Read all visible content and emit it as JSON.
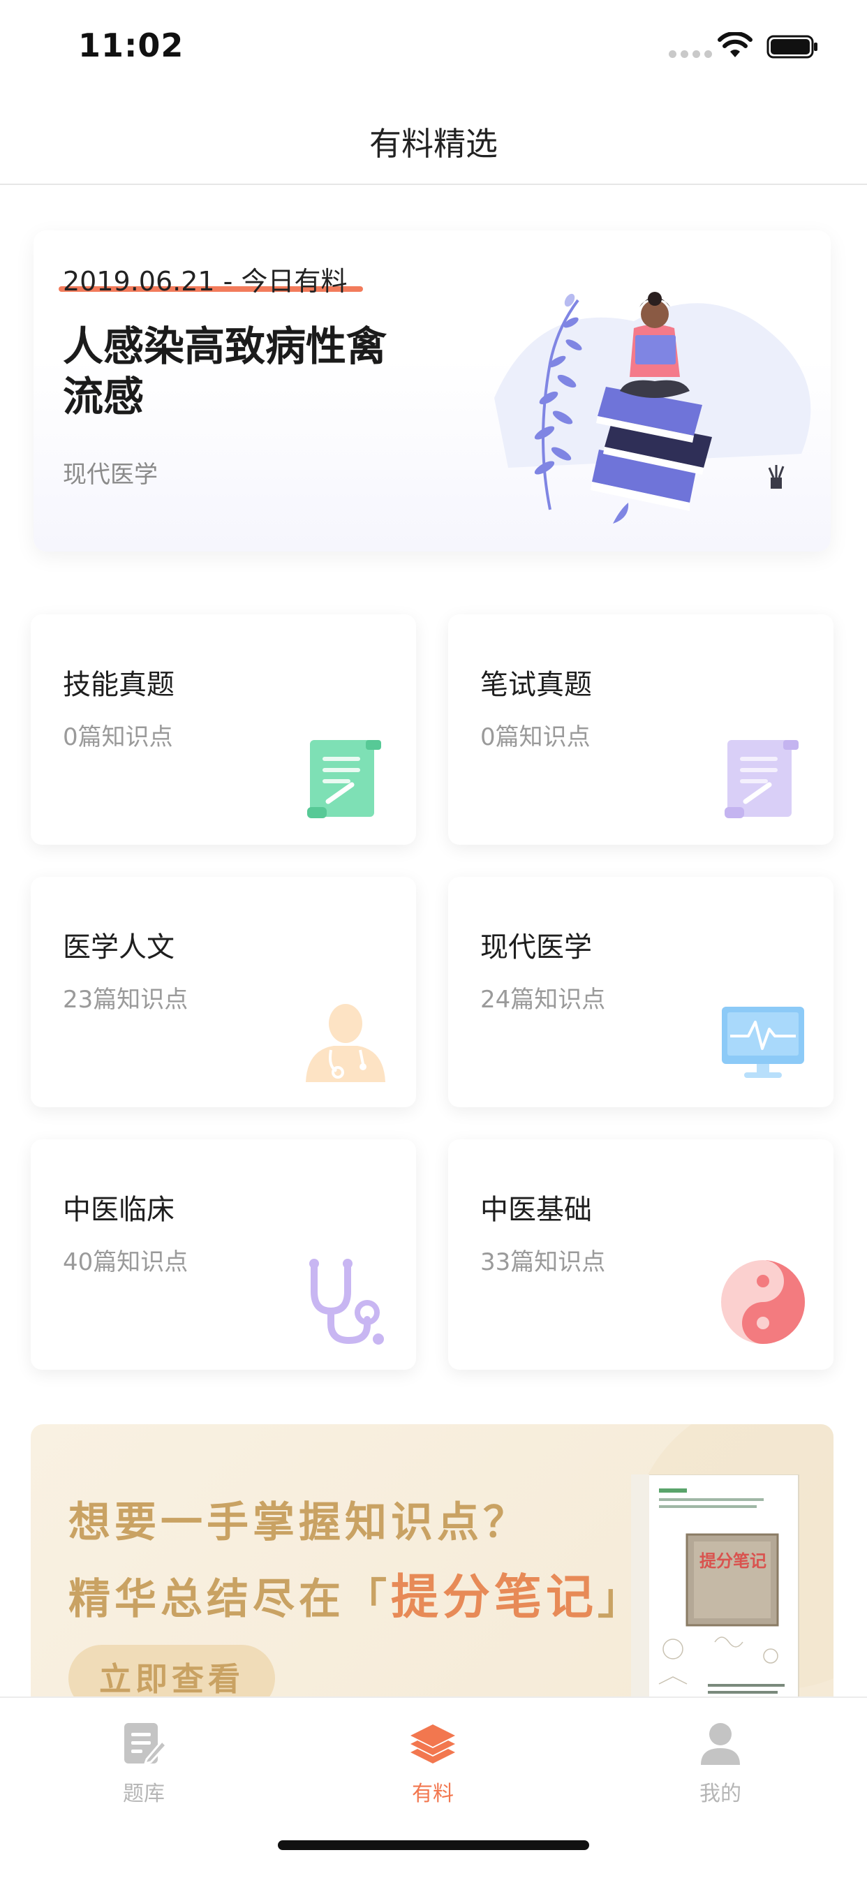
{
  "status_bar": {
    "time": "11:02"
  },
  "nav": {
    "title": "有料精选"
  },
  "hero": {
    "date": "2019.06.21 - 今日有料",
    "title": "人感染高致病性禽流感",
    "tag": "现代医学"
  },
  "categories": [
    {
      "title": "技能真题",
      "count": "0篇知识点",
      "icon": "scroll-icon"
    },
    {
      "title": "笔试真题",
      "count": "0篇知识点",
      "icon": "scroll-icon"
    },
    {
      "title": "医学人文",
      "count": "23篇知识点",
      "icon": "doctor-icon"
    },
    {
      "title": "现代医学",
      "count": "24篇知识点",
      "icon": "monitor-icon"
    },
    {
      "title": "中医临床",
      "count": "40篇知识点",
      "icon": "stethoscope-icon"
    },
    {
      "title": "中医基础",
      "count": "33篇知识点",
      "icon": "yin-yang-icon"
    }
  ],
  "promo": {
    "line1": "想要一手掌握知识点？",
    "line2_prefix": "精华总结尽在「",
    "line2_highlight": "提分笔记",
    "line2_suffix": "」",
    "button": "立即查看",
    "book_title": "提分笔记"
  },
  "tabbar": {
    "items": [
      {
        "label": "题库",
        "icon": "question-bank-icon",
        "active": false
      },
      {
        "label": "有料",
        "icon": "layers-icon",
        "active": true
      },
      {
        "label": "我的",
        "icon": "profile-icon",
        "active": false
      }
    ]
  },
  "colors": {
    "accent": "#f2774f",
    "promo_gold": "#c9a263"
  }
}
